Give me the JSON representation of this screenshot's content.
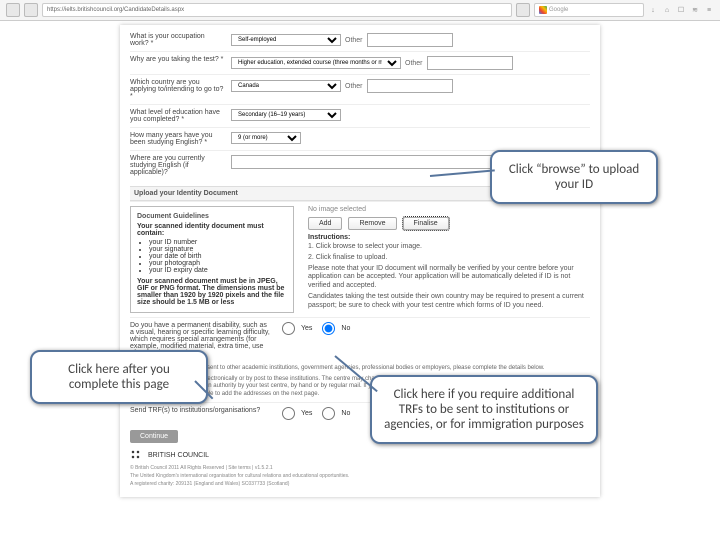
{
  "browser": {
    "url": "https://ielts.britishcouncil.org/CandidateDetails.aspx",
    "search_placeholder": "Google"
  },
  "form": {
    "q_occupation": {
      "label": "What is your occupation work? *",
      "value": "Self-employed",
      "other": "Other"
    },
    "q_reason": {
      "label": "Why are you taking the test? *",
      "value": "Higher education, extended course (three months or more)",
      "other": "Other"
    },
    "q_country": {
      "label": "Which country are you applying to/intending to go to? *",
      "value": "Canada",
      "other": "Other"
    },
    "q_education": {
      "label": "What level of education have you completed? *",
      "value": "Secondary (16–19 years)"
    },
    "q_years_english": {
      "label": "How many years have you been studying English? *",
      "value": "9 (or more)"
    },
    "q_currently_studying": {
      "label": "Where are you currently studying English (if applicable)?",
      "value": ""
    }
  },
  "upload": {
    "section_title": "Upload your Identity Document",
    "guidelines_title": "Document Guidelines",
    "must_contain": "Your scanned identity document must contain:",
    "items": [
      "your ID number",
      "your signature",
      "your date of birth",
      "your photograph",
      "your ID expiry date"
    ],
    "limit": "Your scanned document must be in JPEG, GIF or PNG format. The dimensions must be smaller than 1920 by 1920 pixels and the file size should be 1.5 MB or less",
    "no_image": "No image selected",
    "add": "Add",
    "remove": "Remove",
    "finalise": "Finalise",
    "instructions_title": "Instructions:",
    "instr1": "1. Click browse to select your image.",
    "instr2": "2. Click finalise to upload.",
    "para1": "Please note that your ID document will normally be verified by your centre before your application can be accepted. Your application will be automatically deleted if ID is not verified and accepted.",
    "para2": "Candidates taking the test outside their own country may be required to present a current passport; be sure to check with your test centre which forms of ID you need."
  },
  "disability": {
    "label": "Do you have a permanent disability, such as a visual, hearing or specific learning difficulty, which requires special arrangements (for example, modified material, extra time, use of technology, etc.)?",
    "yes": "Yes",
    "no": "No"
  },
  "trf": {
    "intro": "If you would like your results sent to other academic institutions, government agencies, professional bodies or employers, please complete the details below.",
    "note": "Results may be sent either electronically or by post to these institutions. The centre may charge a fee for results sent internationally or by courier. The Test Report Form will NOT be sent to an immigration authority by your test centre, by hand or by regular mail. If you are applying for immigration, you must send the Test Report Form yourself; if you select 'Yes' you will be able to add the addresses on the next page.",
    "question": "Send TRF(s) to institutions/organisations?",
    "yes": "Yes",
    "no": "No"
  },
  "continue_label": "Continue",
  "brand": "BRITISH COUNCIL",
  "footer_line1": "© British Council 2011  All Rights Reserved  |  Site terms  |  v1.5.2.1",
  "footer_line2": "The United Kingdom's international organisation for cultural relations and educational opportunities.",
  "footer_line3": "A registered charity: 209131 (England and Wales) SC037733 (Scotland)",
  "callouts": {
    "c1": "Click “browse” to upload your ID",
    "c2": "Click here after you complete this page",
    "c3": "Click here if you require additional TRFs to be sent to institutions or agencies, or for  immigration purposes"
  }
}
